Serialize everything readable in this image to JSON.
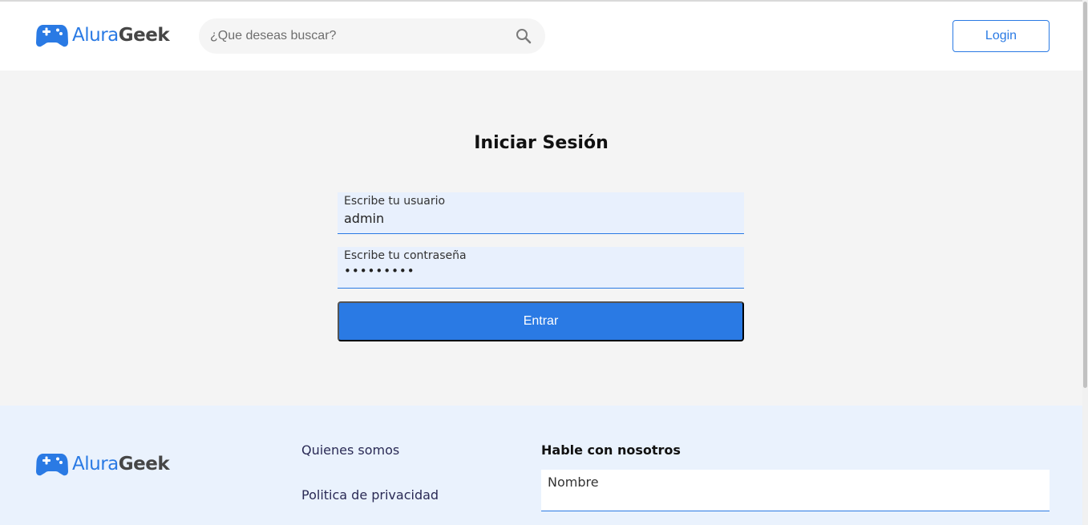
{
  "brand": {
    "name_part1": "Alura",
    "name_part2": "Geek",
    "logo_icon": "gamepad-icon",
    "accent_color": "#2a7ae4"
  },
  "header": {
    "search": {
      "placeholder": "¿Que deseas buscar?",
      "value": "",
      "icon": "search-icon"
    },
    "login_label": "Login"
  },
  "main": {
    "title": "Iniciar Sesión",
    "username": {
      "label": "Escribe tu usuario",
      "value": "admin"
    },
    "password": {
      "label": "Escribe tu contraseña",
      "masked_value": "•••••••••"
    },
    "submit_label": "Entrar"
  },
  "footer": {
    "links": [
      {
        "label": "Quienes somos"
      },
      {
        "label": "Politica de privacidad"
      }
    ],
    "contact": {
      "title": "Hable con nosotros",
      "name_label": "Nombre"
    }
  }
}
